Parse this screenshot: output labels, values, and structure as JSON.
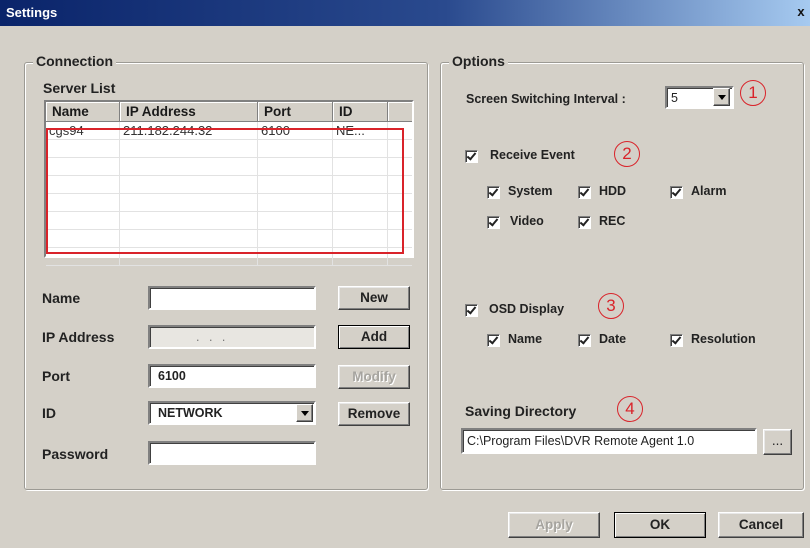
{
  "window": {
    "title": "Settings",
    "close_glyph": "x"
  },
  "connection": {
    "group_label": "Connection",
    "server_list_label": "Server List",
    "columns": [
      "Name",
      "IP Address",
      "Port",
      "ID"
    ],
    "rows": [
      {
        "name": "cgs94",
        "ip": "211.182.244.32",
        "port": "6100",
        "id": "NE..."
      }
    ],
    "fields": {
      "name_label": "Name",
      "name_value": "",
      "ip_label": "IP Address",
      "ip_value": ".  .  .",
      "port_label": "Port",
      "port_value": "6100",
      "id_label": "ID",
      "id_value": "NETWORK",
      "password_label": "Password",
      "password_value": ""
    },
    "buttons": {
      "new": "New",
      "add": "Add",
      "modify": "Modify",
      "remove": "Remove"
    }
  },
  "options": {
    "group_label": "Options",
    "interval_label": "Screen Switching Interval :",
    "interval_value": "5",
    "receive_event_label": "Receive Event",
    "receive_event_checked": true,
    "event_items": [
      {
        "label": "System",
        "checked": true
      },
      {
        "label": "HDD",
        "checked": true
      },
      {
        "label": "Alarm",
        "checked": true
      },
      {
        "label": "Video",
        "checked": true
      },
      {
        "label": "REC",
        "checked": true
      }
    ],
    "osd_label": "OSD Display",
    "osd_checked": true,
    "osd_items": [
      {
        "label": "Name",
        "checked": true
      },
      {
        "label": "Date",
        "checked": true
      },
      {
        "label": "Resolution",
        "checked": true
      }
    ],
    "saving_dir_label": "Saving Directory",
    "saving_dir_value": "C:\\Program Files\\DVR Remote Agent 1.0",
    "browse_label": "..."
  },
  "annotations": {
    "markers": [
      "1",
      "2",
      "3",
      "4"
    ],
    "color": "#d9232a"
  },
  "footer": {
    "apply": "Apply",
    "ok": "OK",
    "cancel": "Cancel"
  }
}
